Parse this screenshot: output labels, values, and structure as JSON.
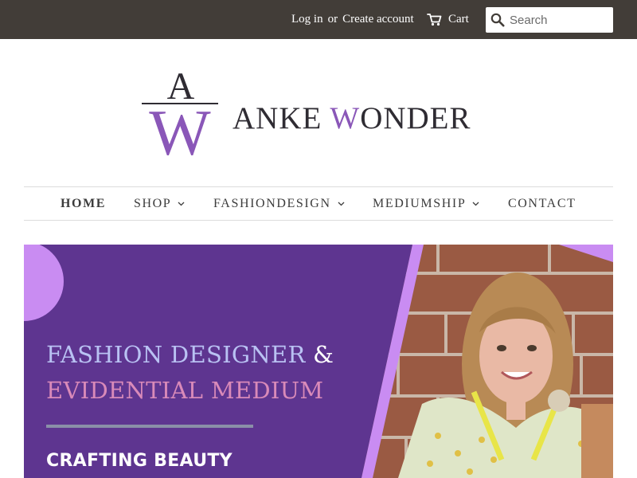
{
  "header": {
    "login_label": "Log in",
    "or_label": "or",
    "create_account_label": "Create account",
    "cart_label": "Cart",
    "search_placeholder": "Search"
  },
  "logo": {
    "letter_a": "A",
    "letter_w": "W",
    "text_prefix": "ANKE ",
    "text_w": "W",
    "text_suffix": "ONDER"
  },
  "nav": {
    "items": [
      {
        "label": "HOME",
        "active": true,
        "dropdown": false
      },
      {
        "label": "SHOP",
        "active": false,
        "dropdown": true
      },
      {
        "label": "FASHIONDESIGN",
        "active": false,
        "dropdown": true
      },
      {
        "label": "MEDIUMSHIP",
        "active": false,
        "dropdown": true
      },
      {
        "label": "CONTACT",
        "active": false,
        "dropdown": false
      }
    ]
  },
  "hero": {
    "headline_1": "FASHION DESIGNER",
    "headline_amp": "&",
    "headline_2": "EVIDENTIAL MEDIUM",
    "tagline": "CRAFTING BEAUTY"
  },
  "colors": {
    "topbar": "#423d38",
    "hero_purple": "#5e3590",
    "accent_lilac": "#c98cf2",
    "logo_purple": "#8a57b8"
  }
}
